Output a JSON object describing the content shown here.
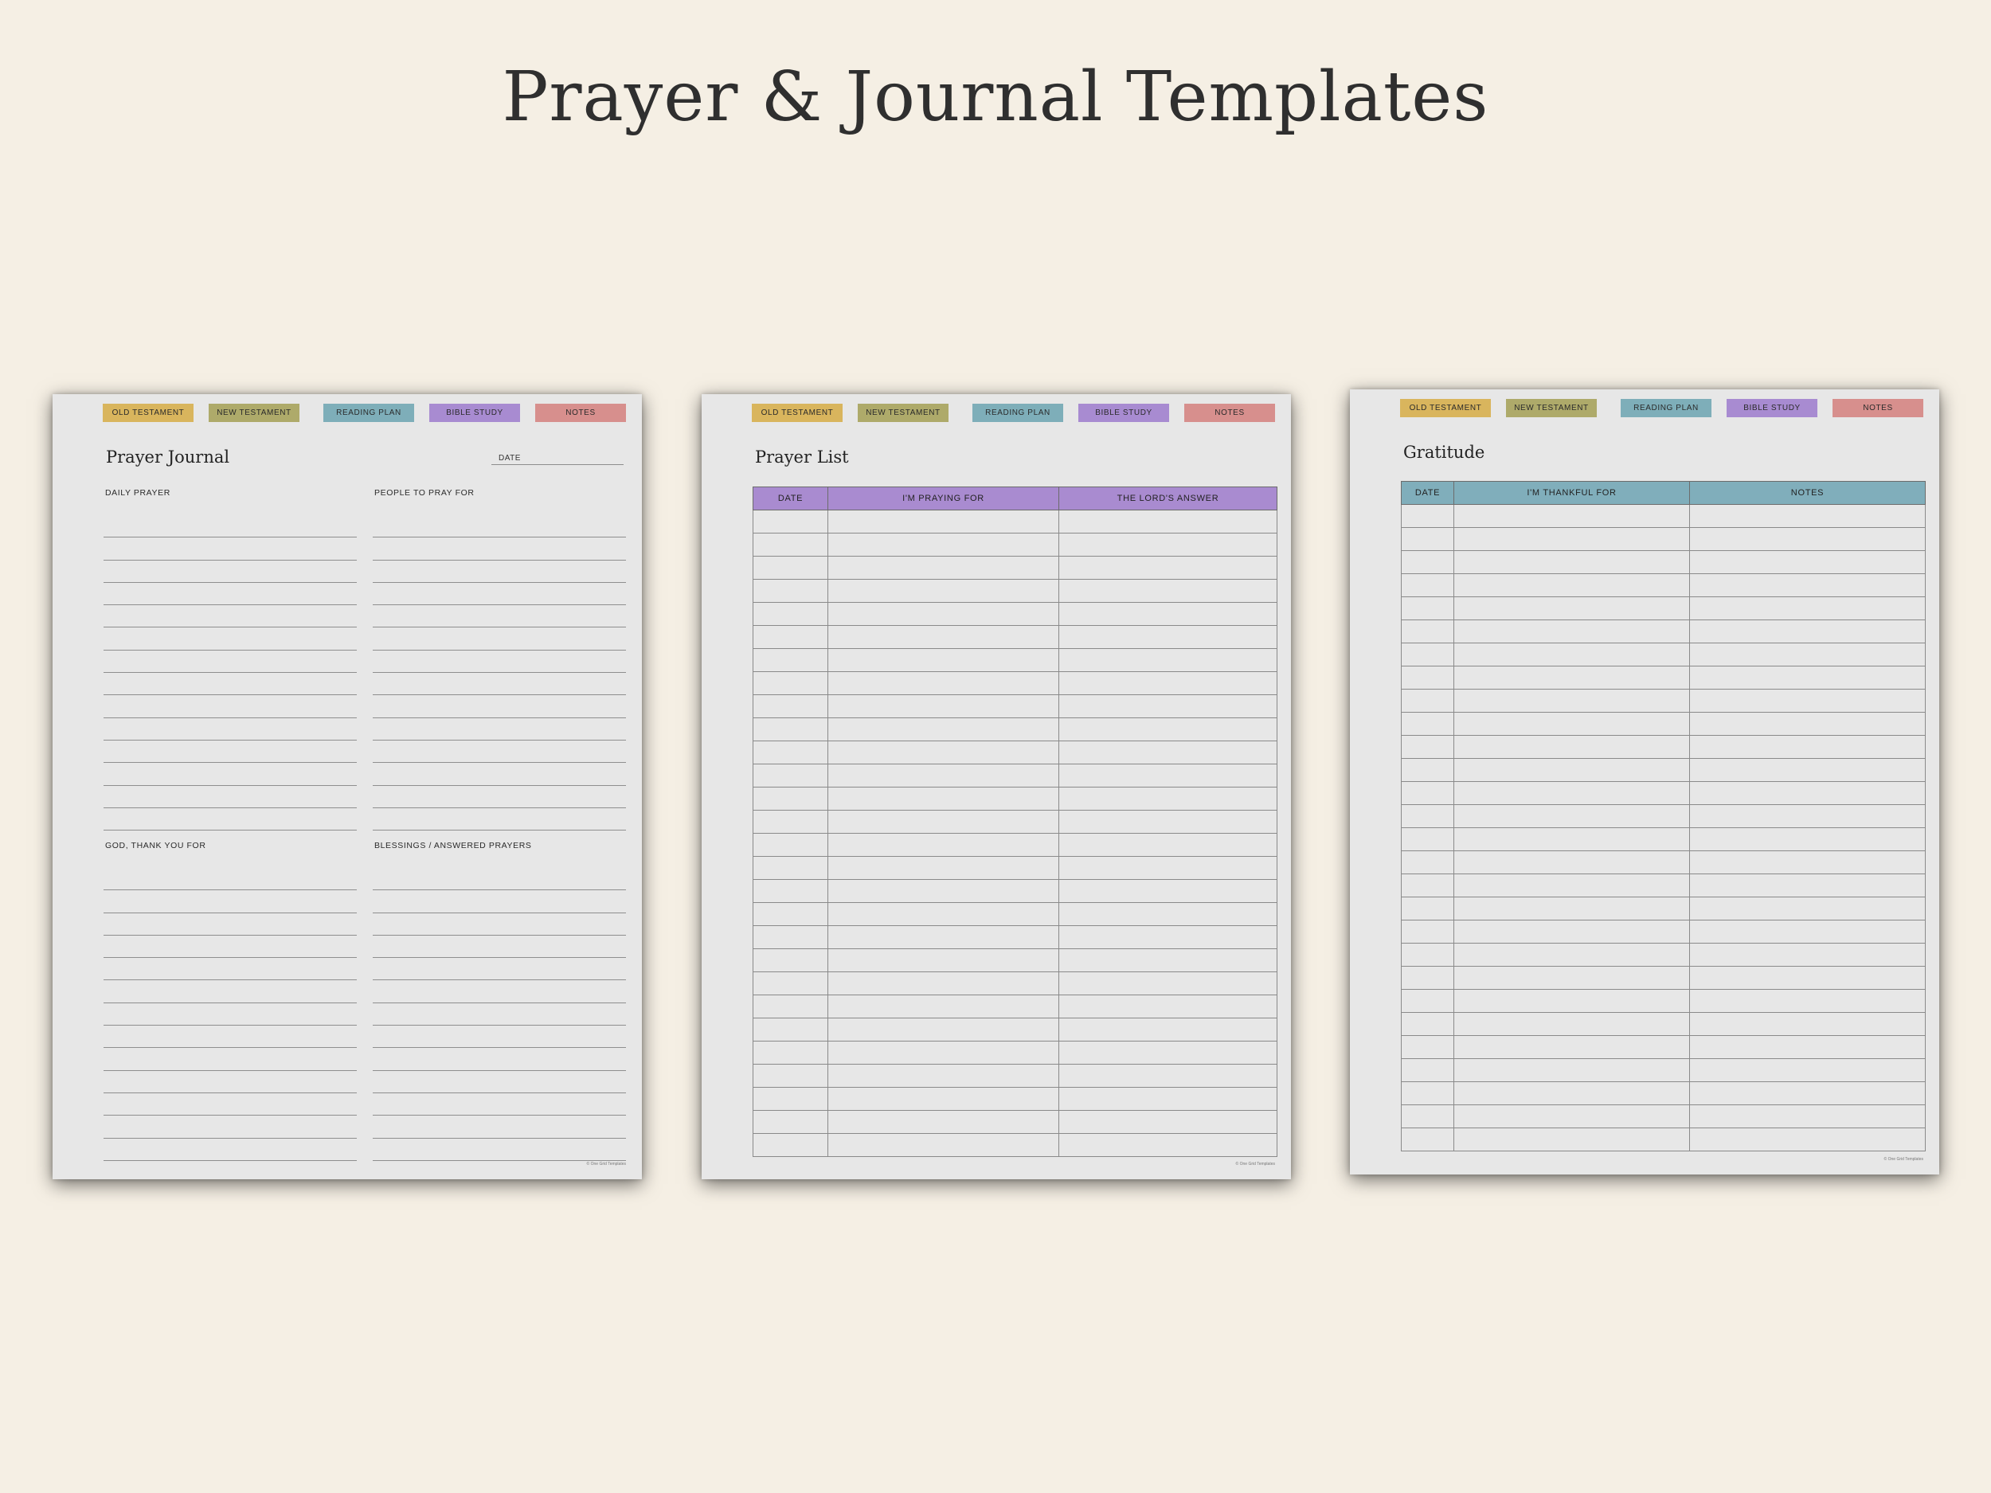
{
  "title": "Prayer & Journal Templates",
  "tabs": [
    {
      "label": "OLD TESTAMENT",
      "color": "#d9b55d"
    },
    {
      "label": "NEW TESTAMENT",
      "color": "#aeaa6a"
    },
    {
      "label": "READING PLAN",
      "color": "#7eaeb9"
    },
    {
      "label": "BIBLE STUDY",
      "color": "#a88bd1"
    },
    {
      "label": "NOTES",
      "color": "#d78f8d"
    }
  ],
  "prayer_journal": {
    "title": "Prayer Journal",
    "date_label": "DATE",
    "sections": [
      "DAILY PRAYER",
      "PEOPLE TO PRAY FOR",
      "GOD, THANK YOU FOR",
      "BLESSINGS / ANSWERED PRAYERS"
    ],
    "footer": "© One Grid Templates"
  },
  "prayer_list": {
    "title": "Prayer List",
    "header_color": "#a98bd0",
    "columns": [
      "DATE",
      "I'M PRAYING FOR",
      "THE LORD'S ANSWER"
    ],
    "footer": "© One Grid Templates"
  },
  "gratitude": {
    "title": "Gratitude",
    "header_color": "#80aebb",
    "columns": [
      "DATE",
      "I'M THANKFUL FOR",
      "NOTES"
    ],
    "footer": "© One Grid Templates"
  }
}
